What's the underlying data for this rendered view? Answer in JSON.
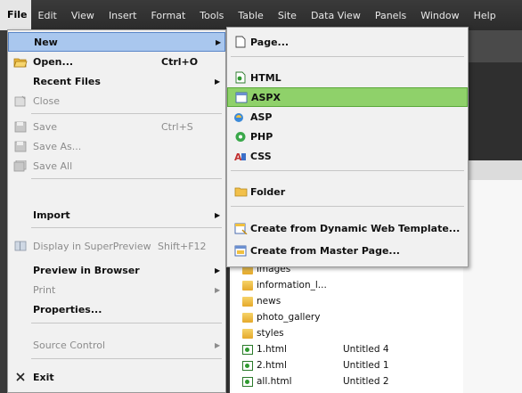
{
  "menubar": {
    "items": [
      "File",
      "Edit",
      "View",
      "Insert",
      "Format",
      "Tools",
      "Table",
      "Site",
      "Data View",
      "Panels",
      "Window",
      "Help"
    ]
  },
  "file_menu": {
    "new": "New",
    "open": "Open...",
    "open_shortcut": "Ctrl+O",
    "recent_files": "Recent Files",
    "close": "Close",
    "save": "Save",
    "save_shortcut": "Ctrl+S",
    "save_as": "Save As...",
    "save_all": "Save All",
    "import": "Import",
    "display_superpreview": "Display in SuperPreview",
    "display_superpreview_shortcut": "Shift+F12",
    "preview_in_browser": "Preview in Browser",
    "print": "Print",
    "properties": "Properties...",
    "source_control": "Source Control",
    "exit": "Exit"
  },
  "new_submenu": {
    "page": "Page...",
    "html": "HTML",
    "aspx": "ASPX",
    "asp": "ASP",
    "php": "PHP",
    "css": "CSS",
    "folder": "Folder",
    "from_dwt": "Create from Dynamic Web Template...",
    "from_master": "Create from Master Page..."
  },
  "file_list": [
    {
      "name": "images",
      "type": "folder",
      "title": ""
    },
    {
      "name": "information_l...",
      "type": "folder",
      "title": ""
    },
    {
      "name": "news",
      "type": "folder",
      "title": ""
    },
    {
      "name": "photo_gallery",
      "type": "folder",
      "title": ""
    },
    {
      "name": "styles",
      "type": "folder",
      "title": ""
    },
    {
      "name": "1.html",
      "type": "html",
      "title": "Untitled 4"
    },
    {
      "name": "2.html",
      "type": "html",
      "title": "Untitled 1"
    },
    {
      "name": "all.html",
      "type": "html",
      "title": "Untitled 2"
    }
  ],
  "colors": {
    "menu_highlight": "#a9c7ee",
    "submenu_highlight": "#8fd16a",
    "menubar_bg": "#2b2b2b"
  }
}
